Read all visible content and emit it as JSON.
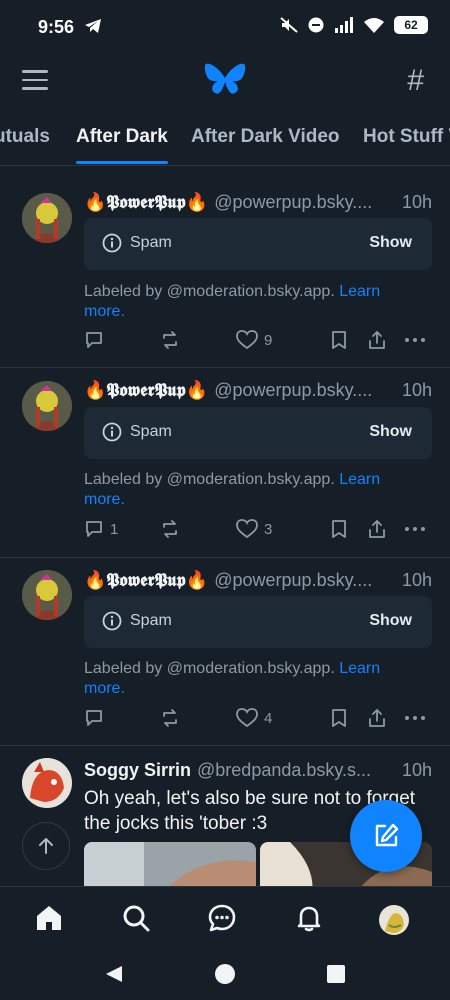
{
  "status_bar": {
    "time": "9:56",
    "battery": "62"
  },
  "header": {
    "menu_icon": "hamburger-icon",
    "logo": "butterfly-logo",
    "feeds_icon": "hash-icon"
  },
  "tabs": [
    {
      "label": "utuals",
      "active": false
    },
    {
      "label": "After Dark",
      "active": true
    },
    {
      "label": "After Dark Video",
      "active": false
    },
    {
      "label": "Hot Stuff V",
      "active": false
    }
  ],
  "posts": [
    {
      "author_name": "🔥𝕻𝖔𝖜𝖊𝖗𝕻𝖚𝖕🔥",
      "handle": "@powerpup.bsky....",
      "time": "10h",
      "label": "Spam",
      "show_label": "Show",
      "labeled_by": "Labeled by @moderation.bsky.app.",
      "learn_more": "Learn more.",
      "reply_count": "",
      "like_count": "9"
    },
    {
      "author_name": "🔥𝕻𝖔𝖜𝖊𝖗𝕻𝖚𝖕🔥",
      "handle": "@powerpup.bsky....",
      "time": "10h",
      "label": "Spam",
      "show_label": "Show",
      "labeled_by": "Labeled by @moderation.bsky.app.",
      "learn_more": "Learn more.",
      "reply_count": "1",
      "like_count": "3"
    },
    {
      "author_name": "🔥𝕻𝖔𝖜𝖊𝖗𝕻𝖚𝖕🔥",
      "handle": "@powerpup.bsky....",
      "time": "10h",
      "label": "Spam",
      "show_label": "Show",
      "labeled_by": "Labeled by @moderation.bsky.app.",
      "learn_more": "Learn more.",
      "reply_count": "",
      "like_count": "4"
    },
    {
      "author_name": "Soggy Sirrin",
      "handle": "@bredpanda.bsky.s...",
      "time": "10h",
      "text": "Oh yeah, let's also be sure not to forget the jocks this 'tober :3"
    }
  ],
  "colors": {
    "background": "#161e27",
    "accent": "#1083fe",
    "muted": "#8d99a6",
    "divider": "#2a3441"
  }
}
